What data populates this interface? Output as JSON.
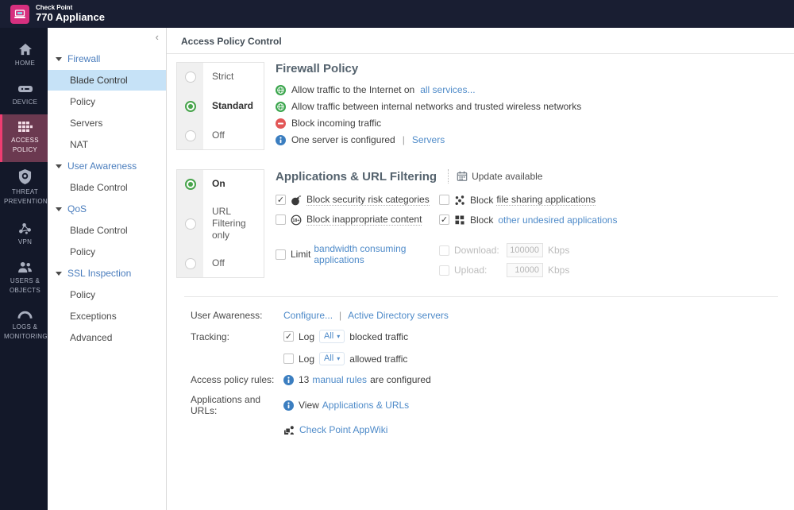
{
  "header": {
    "brand_top": "Check Point",
    "brand_bottom": "770 Appliance"
  },
  "primary_nav": {
    "items": [
      {
        "label": "HOME"
      },
      {
        "label": "DEVICE"
      },
      {
        "label": "ACCESS POLICY",
        "active": true
      },
      {
        "label": "THREAT PREVENTION"
      },
      {
        "label": "VPN"
      },
      {
        "label": "USERS & OBJECTS"
      },
      {
        "label": "LOGS & MONITORING"
      }
    ]
  },
  "secondary_nav": {
    "collapse_icon": "‹",
    "sections": [
      {
        "label": "Firewall",
        "items": [
          "Blade Control",
          "Policy",
          "Servers",
          "NAT"
        ],
        "active_item": "Blade Control"
      },
      {
        "label": "User Awareness",
        "items": [
          "Blade Control"
        ]
      },
      {
        "label": "QoS",
        "items": [
          "Blade Control",
          "Policy"
        ]
      },
      {
        "label": "SSL Inspection",
        "items": [
          "Policy",
          "Exceptions",
          "Advanced"
        ]
      }
    ]
  },
  "page": {
    "title": "Access Policy Control"
  },
  "firewall": {
    "heading": "Firewall Policy",
    "options": [
      "Strict",
      "Standard",
      "Off"
    ],
    "selected": "Standard",
    "b1_text": "Allow traffic to the Internet on",
    "b1_link": "all services...",
    "b2_text": "Allow traffic between internal networks and trusted wireless networks",
    "b3_text": "Block incoming traffic",
    "b4_text": "One server is configured",
    "b4_sep": "|",
    "b4_link": "Servers"
  },
  "apps": {
    "heading": "Applications & URL Filtering",
    "update_label": "Update available",
    "options": [
      "On",
      "URL Filtering only",
      "Off"
    ],
    "selected": "On",
    "cb_security": "Block security risk categories",
    "cb_inappropriate": "Block inappropriate content",
    "cb_filesharing_pre": "Block",
    "cb_filesharing_tip": "file sharing applications",
    "cb_undesired_pre": "Block",
    "cb_undesired_link": "other undesired applications",
    "limit_pre": "Limit",
    "limit_link": "bandwidth consuming applications",
    "download_label": "Download:",
    "download_value": "100000",
    "download_unit": "Kbps",
    "upload_label": "Upload:",
    "upload_value": "10000",
    "upload_unit": "Kbps"
  },
  "settings": {
    "user_awareness_label": "User Awareness:",
    "configure_link": "Configure...",
    "sep": "|",
    "ad_link": "Active Directory servers",
    "tracking_label": "Tracking:",
    "log_label": "Log",
    "all_label": "All",
    "blocked_text": "blocked traffic",
    "allowed_text": "allowed traffic",
    "rules_label": "Access policy rules:",
    "rules_count": "13",
    "rules_link": "manual rules",
    "rules_suffix": "are configured",
    "apps_label": "Applications and URLs:",
    "view_text": "View",
    "view_link": "Applications & URLs",
    "appwiki_link": "Check Point AppWiki"
  }
}
